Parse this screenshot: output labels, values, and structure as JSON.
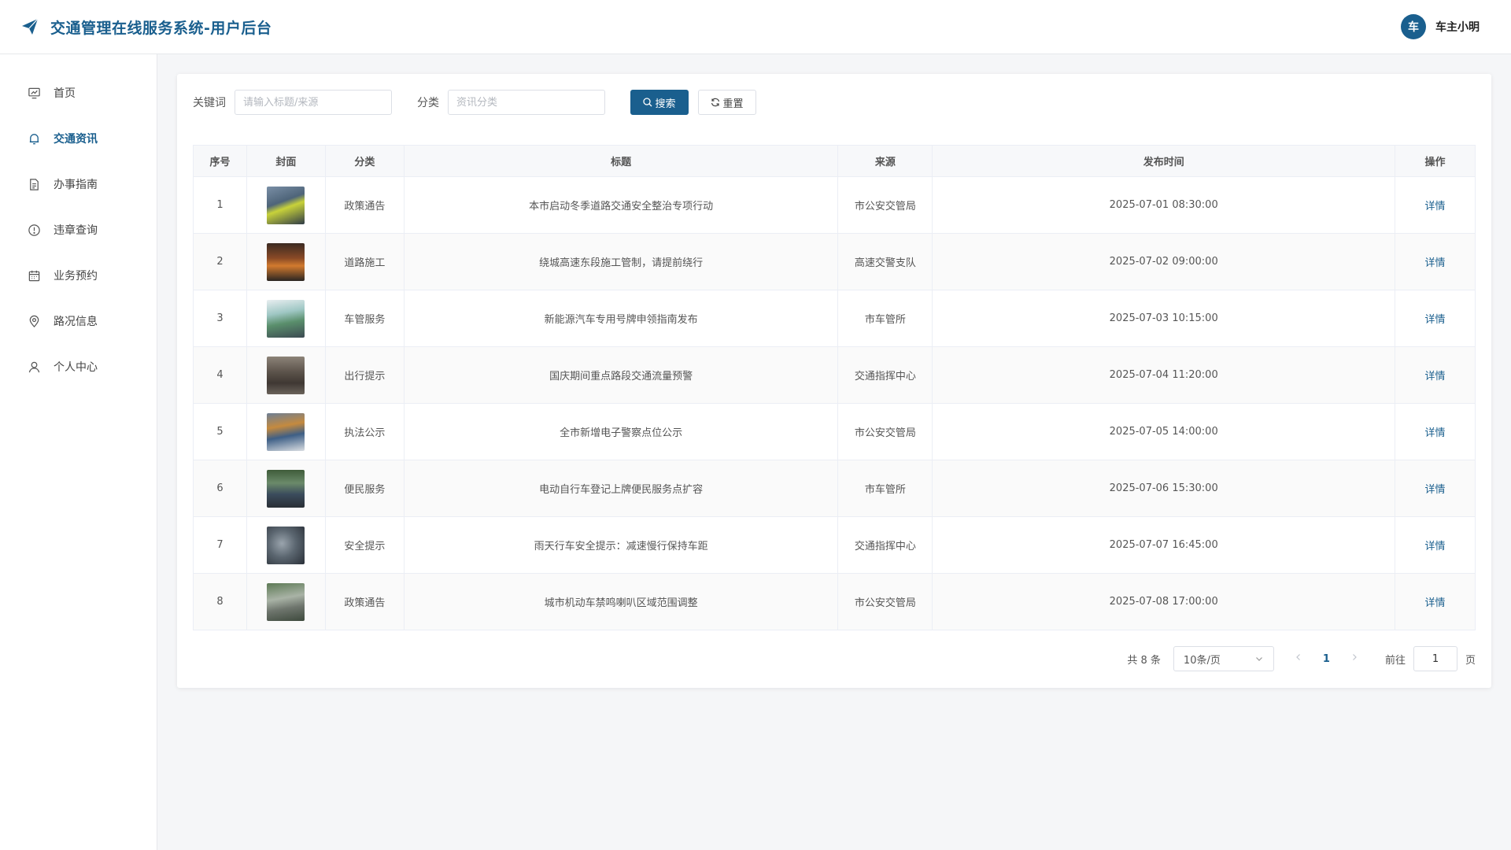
{
  "header": {
    "title": "交通管理在线服务系统-用户后台",
    "avatar_text": "车",
    "user_name": "车主小明"
  },
  "sidebar": {
    "items": [
      {
        "label": "首页",
        "icon": "dashboard-icon"
      },
      {
        "label": "交通资讯",
        "icon": "bell-icon"
      },
      {
        "label": "办事指南",
        "icon": "document-icon"
      },
      {
        "label": "违章查询",
        "icon": "warning-icon"
      },
      {
        "label": "业务预约",
        "icon": "calendar-icon"
      },
      {
        "label": "路况信息",
        "icon": "location-icon"
      },
      {
        "label": "个人中心",
        "icon": "user-icon"
      }
    ],
    "active_index": 1
  },
  "filters": {
    "keyword_label": "关键词",
    "keyword_placeholder": "请输入标题/来源",
    "category_label": "分类",
    "category_placeholder": "资讯分类",
    "search_label": "搜索",
    "reset_label": "重置"
  },
  "table": {
    "columns": [
      "序号",
      "封面",
      "分类",
      "标题",
      "来源",
      "发布时间",
      "操作"
    ],
    "rows": [
      {
        "index": "1",
        "category": "政策通告",
        "title": "本市启动冬季道路交通安全整治专项行动",
        "source": "市公安交管局",
        "time": "2025-07-01 08:30:00",
        "action": "详情"
      },
      {
        "index": "2",
        "category": "道路施工",
        "title": "绕城高速东段施工管制，请提前绕行",
        "source": "高速交警支队",
        "time": "2025-07-02 09:00:00",
        "action": "详情"
      },
      {
        "index": "3",
        "category": "车管服务",
        "title": "新能源汽车专用号牌申领指南发布",
        "source": "市车管所",
        "time": "2025-07-03 10:15:00",
        "action": "详情"
      },
      {
        "index": "4",
        "category": "出行提示",
        "title": "国庆期间重点路段交通流量预警",
        "source": "交通指挥中心",
        "time": "2025-07-04 11:20:00",
        "action": "详情"
      },
      {
        "index": "5",
        "category": "执法公示",
        "title": "全市新增电子警察点位公示",
        "source": "市公安交管局",
        "time": "2025-07-05 14:00:00",
        "action": "详情"
      },
      {
        "index": "6",
        "category": "便民服务",
        "title": "电动自行车登记上牌便民服务点扩容",
        "source": "市车管所",
        "time": "2025-07-06 15:30:00",
        "action": "详情"
      },
      {
        "index": "7",
        "category": "安全提示",
        "title": "雨天行车安全提示：减速慢行保持车距",
        "source": "交通指挥中心",
        "time": "2025-07-07 16:45:00",
        "action": "详情"
      },
      {
        "index": "8",
        "category": "政策通告",
        "title": "城市机动车禁鸣喇叭区域范围调整",
        "source": "市公安交管局",
        "time": "2025-07-08 17:00:00",
        "action": "详情"
      }
    ]
  },
  "pagination": {
    "total_text": "共 8 条",
    "page_size": "10条/页",
    "current_page": "1",
    "goto_label": "前往",
    "goto_value": "1",
    "page_suffix": "页"
  },
  "colors": {
    "primary": "#1a5f8e"
  }
}
